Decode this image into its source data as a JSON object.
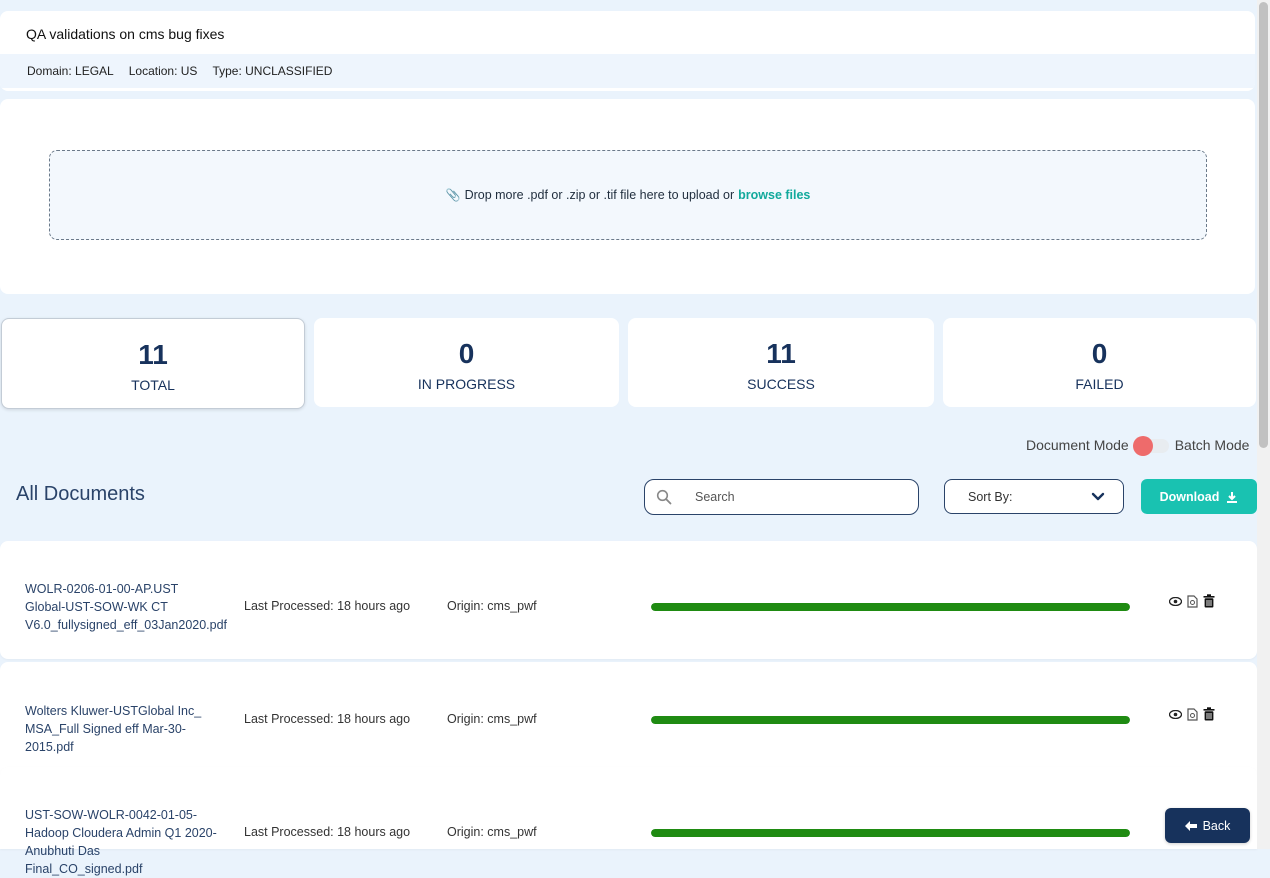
{
  "header": {
    "title": "QA validations on cms bug fixes",
    "domain": "Domain: LEGAL",
    "location": "Location: US",
    "type": "Type: UNCLASSIFIED"
  },
  "upload": {
    "prompt": "Drop more .pdf or .zip or .tif file here to upload or",
    "browse_label": "browse files"
  },
  "stats": [
    {
      "value": "11",
      "label": "TOTAL"
    },
    {
      "value": "0",
      "label": "IN PROGRESS"
    },
    {
      "value": "11",
      "label": "SUCCESS"
    },
    {
      "value": "0",
      "label": "FAILED"
    }
  ],
  "mode": {
    "left_label": "Document Mode",
    "right_label": "Batch Mode",
    "active_color": "#ee6b6b"
  },
  "toolbar": {
    "section_title": "All Documents",
    "search_placeholder": "Search",
    "sort_label": "Sort By:",
    "download_label": "Download"
  },
  "documents": [
    {
      "name": "WOLR-0206-01-00-AP.UST  Global-UST-SOW-WK  CT V6.0_fullysigned_eff_03Jan2020.pdf",
      "processed": "Last Processed: 18 hours ago",
      "origin": "Origin: cms_pwf",
      "progress": 1.0
    },
    {
      "name": "Wolters Kluwer-USTGlobal Inc_ MSA_Full Signed eff Mar-30-2015.pdf",
      "processed": "Last Processed: 18 hours ago",
      "origin": "Origin: cms_pwf",
      "progress": 1.0
    },
    {
      "name": "UST-SOW-WOLR-0042-01-05-Hadoop Cloudera Admin Q1 2020-Anubhuti Das Final_CO_signed.pdf",
      "processed": "Last Processed: 18 hours ago",
      "origin": "Origin: cms_pwf",
      "progress": 1.0
    }
  ],
  "back_label": "Back",
  "colors": {
    "accent": "#19c2b1",
    "navy": "#17325c",
    "progress": "#1f8b12"
  }
}
